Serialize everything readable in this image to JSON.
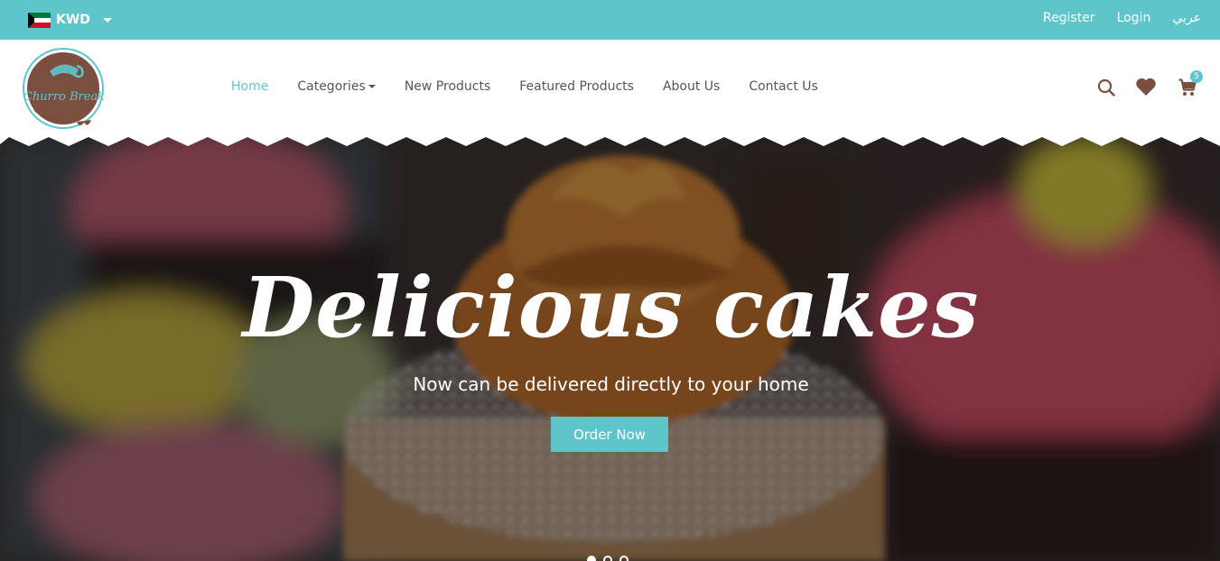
{
  "topbar": {
    "currency": "KWD",
    "links": {
      "register": "Register",
      "login": "Login",
      "language": "عربي"
    }
  },
  "logo": {
    "text": "Churro Break"
  },
  "nav": {
    "items": [
      {
        "label": "Home",
        "active": true
      },
      {
        "label": "Categories",
        "has_dropdown": true
      },
      {
        "label": "New Products"
      },
      {
        "label": "Featured Products"
      },
      {
        "label": "About Us"
      },
      {
        "label": "Contact Us"
      }
    ]
  },
  "header_icons": {
    "search": "search-icon",
    "wishlist": "heart-icon",
    "cart": "cart-icon",
    "cart_count": "5"
  },
  "hero": {
    "title": "Delicious cakes",
    "subtitle": "Now can be delivered directly to your home",
    "cta": "Order Now",
    "slides": 3,
    "active_slide": 1
  },
  "colors": {
    "accent": "#5ec6cb",
    "brand_brown": "#7b4f3f",
    "nav_text": "#555555"
  }
}
